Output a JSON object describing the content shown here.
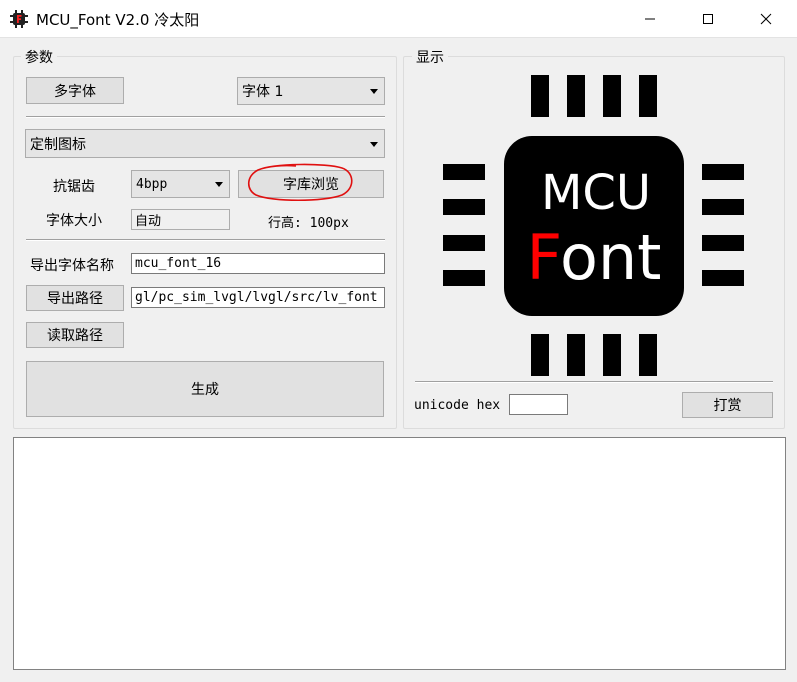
{
  "window": {
    "title": "MCU_Font V2.0  冷太阳",
    "icon": "app-f-icon",
    "controls": [
      "minimize-icon",
      "maximize-icon",
      "close-icon"
    ]
  },
  "params": {
    "group_label": "参数",
    "multi_font_button": "多字体",
    "font_select": {
      "value": "字体 1"
    },
    "icon_select": {
      "value": "定制图标"
    },
    "antialias_label": "抗锯齿",
    "antialias_select": {
      "value": "4bpp"
    },
    "browse_button": "字库浏览",
    "font_size_label": "字体大小",
    "font_size_value": "自动",
    "line_height_text": "行高: 100px",
    "export_name_label": "导出字体名称",
    "export_name_value": "mcu_font_16",
    "export_path_button": "导出路径",
    "export_path_value": "gl/pc_sim_lvgl/lvgl/src/lv_font",
    "read_path_button": "读取路径",
    "generate_button": "生成"
  },
  "display": {
    "group_label": "显示",
    "logo": {
      "line1": "MCU",
      "line2_accent": "F",
      "line2_rest": "ont",
      "accent_color": "#ff0000"
    },
    "unicode_label": "unicode hex",
    "unicode_value": "",
    "donate_button": "打赏"
  },
  "log": {
    "text": ""
  }
}
